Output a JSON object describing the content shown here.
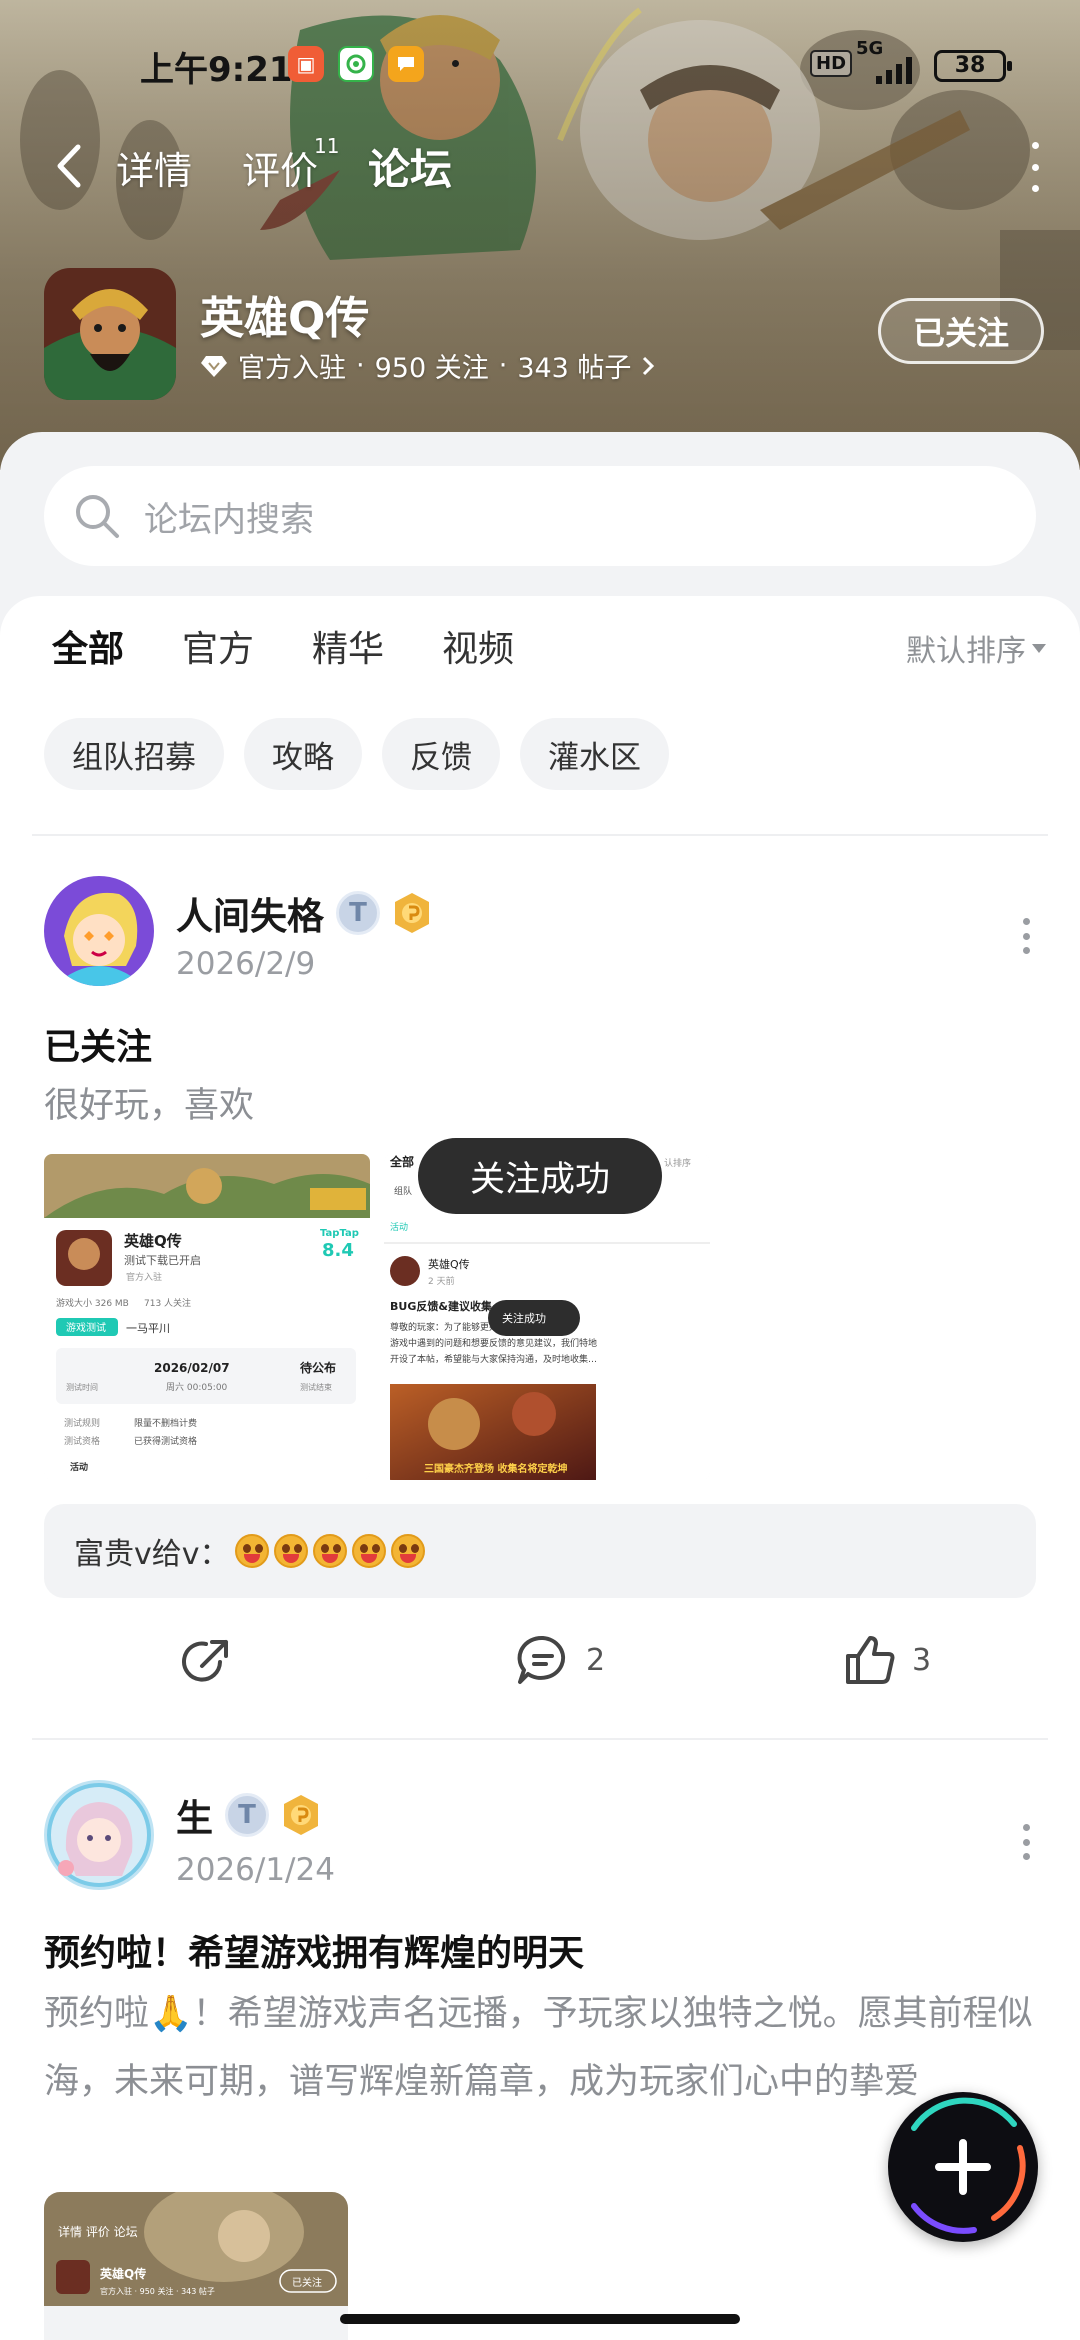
{
  "status_bar": {
    "time": "上午9:21",
    "network": "5G",
    "hd": "HD",
    "battery": "38"
  },
  "nav": {
    "tabs": [
      {
        "label": "详情",
        "badge": ""
      },
      {
        "label": "评价",
        "badge": "11"
      },
      {
        "label": "论坛",
        "badge": ""
      }
    ],
    "active_tab": "论坛"
  },
  "game": {
    "name": "英雄Q传",
    "official": "官方入驻",
    "followers": "950 关注",
    "posts": "343 帖子",
    "separator": "·",
    "follow_label": "已关注"
  },
  "search": {
    "placeholder": "论坛内搜索"
  },
  "forum_tabs": [
    "全部",
    "官方",
    "精华",
    "视频"
  ],
  "active_forum_tab": "全部",
  "sort_label": "默认排序",
  "chips": [
    "组队招募",
    "攻略",
    "反馈",
    "灌水区"
  ],
  "toast": "关注成功",
  "posts": [
    {
      "author": "人间失格",
      "date": "2026/2/9",
      "title": "已关注",
      "body": "很好玩，喜欢",
      "comment_preview": {
        "user": "富贵v给v：",
        "emoji_count": 5
      },
      "shares": "",
      "comments": "2",
      "likes": "3",
      "thumb1": {
        "game": "英雄Q传",
        "sub": "测试下载已开启",
        "official": "官方入驻",
        "score_brand": "TapTap",
        "score": "8.4",
        "size": "游戏大小 326 MB",
        "follow": "713 人关注",
        "test_tag": "游戏测试",
        "test_name": "一马平川",
        "test_time_label": "测试时间",
        "test_date": "2026/02/07",
        "test_date_sub": "周六 00:05:00",
        "test_end": "待公布",
        "test_end_sub": "测试结束",
        "rule_label": "测试规则",
        "rule_value": "限量不删档计费",
        "qual_label": "测试资格",
        "qual_value": "已获得测试资格",
        "activity": "活动"
      },
      "thumb2": {
        "tab": "全部",
        "sort": "认排序",
        "chip": "组队",
        "activity": "活动",
        "game": "英雄Q传",
        "ago": "2 天前",
        "title": "BUG反馈&建议收集",
        "desc1": "尊敬的玩家：为了能够更好的了解冒险家们在",
        "desc2": "游戏中遇到的问题和想要反馈的意见建议，我们特地",
        "desc3": "开设了本帖，希望能与大家保持沟通，及时地收集…",
        "mini_toast": "关注成功",
        "banner": "三国豪杰齐登场 收集名将定乾坤"
      }
    },
    {
      "author": "生",
      "date": "2026/1/24",
      "title": "预约啦！希望游戏拥有辉煌的明天",
      "body": "预约啦🙏！希望游戏声名远播，予玩家以独特之悦。愿其前程似海，未来可期，谱写辉煌新篇章，成为玩家们心中的挚爱",
      "thumb": {
        "tabs": "详情  评价  论坛",
        "game": "英雄Q传",
        "follow": "已关注",
        "meta": "官方入驻 · 950 关注 · 343 帖子"
      }
    }
  ],
  "colors": {
    "accent": "#1fc9b4",
    "gold": "#f0b43c",
    "hero_bg": "#a3916d"
  }
}
